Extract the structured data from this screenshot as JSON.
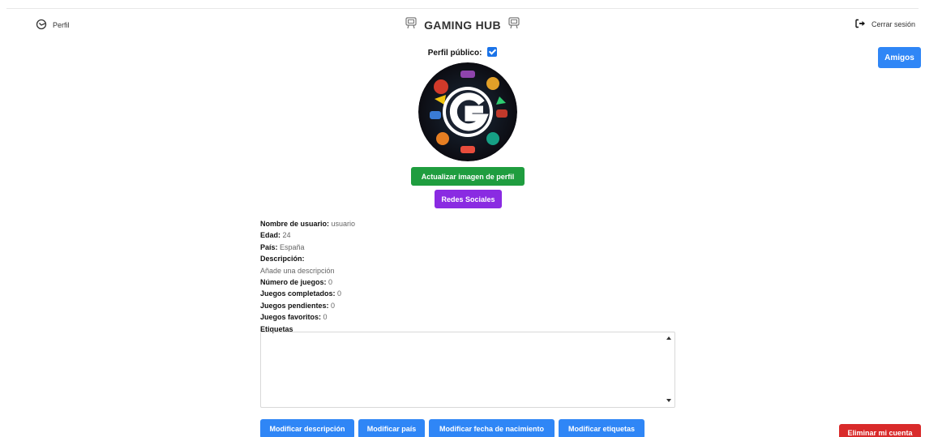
{
  "header": {
    "left_label": "Perfil",
    "left_icon": "user-profile-icon",
    "title": "GAMING HUB",
    "title_icon": "arcade-icon",
    "right_label": "Cerrar sesión",
    "right_icon": "logout-icon"
  },
  "profile": {
    "public_label": "Perfil público:",
    "public_checked": true,
    "avatar_icon": "gaming-hub-logo-avatar"
  },
  "buttons": {
    "friends": "Amigos",
    "update_image": "Actualizar imagen de perfil",
    "social": "Redes Sociales",
    "mod_description": "Modificar descripción",
    "mod_country": "Modificar país",
    "mod_birthdate": "Modificar fecha de nacimiento",
    "mod_tags": "Modificar etiquetas",
    "delete_account": "Eliminar mi cuenta"
  },
  "info": {
    "username_label": "Nombre de usuario:",
    "username": "usuario",
    "age_label": "Edad:",
    "age": "24",
    "country_label": "País:",
    "country": "España",
    "description_label": "Descripción:",
    "description": "Añade una descripción",
    "games_label": "Número de juegos:",
    "games": "0",
    "completed_label": "Juegos completados:",
    "completed": "0",
    "pending_label": "Juegos pendientes:",
    "pending": "0",
    "favorites_label": "Juegos favoritos:",
    "favorites": "0",
    "tags_label": "Etiquetas"
  },
  "colors": {
    "primary": "#2f86f6",
    "success": "#1f9d3f",
    "purple": "#8a2be2",
    "danger": "#d92a2a"
  }
}
